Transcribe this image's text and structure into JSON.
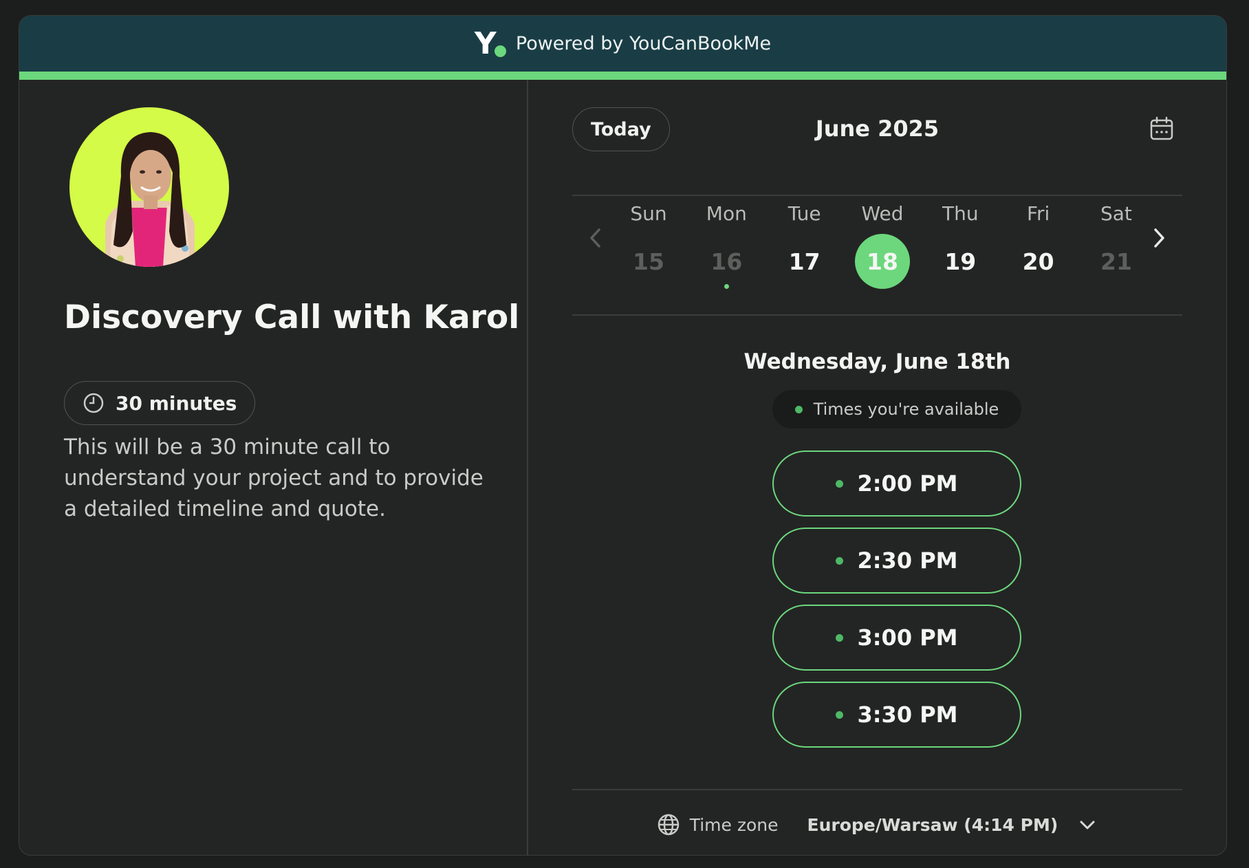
{
  "header": {
    "powered_by": "Powered by YouCanBookMe"
  },
  "profile": {
    "title": "Discovery Call with Karol",
    "duration": "30 minutes",
    "description": "This will be a 30 minute call to understand your project and to provide a detailed timeline and quote."
  },
  "calendar": {
    "today_label": "Today",
    "month": "June 2025",
    "days": [
      {
        "name": "Sun",
        "num": "15",
        "state": "muted",
        "has_dot": false
      },
      {
        "name": "Mon",
        "num": "16",
        "state": "muted",
        "has_dot": true
      },
      {
        "name": "Tue",
        "num": "17",
        "state": "available",
        "has_dot": false
      },
      {
        "name": "Wed",
        "num": "18",
        "state": "selected",
        "has_dot": false
      },
      {
        "name": "Thu",
        "num": "19",
        "state": "available",
        "has_dot": false
      },
      {
        "name": "Fri",
        "num": "20",
        "state": "available",
        "has_dot": false
      },
      {
        "name": "Sat",
        "num": "21",
        "state": "muted",
        "has_dot": false
      }
    ],
    "selected_date": "Wednesday, June 18th",
    "legend": "Times you're available",
    "slots": [
      "2:00 PM",
      "2:30 PM",
      "3:00 PM",
      "3:30 PM"
    ]
  },
  "timezone": {
    "label": "Time zone",
    "value": "Europe/Warsaw (4:14 PM)"
  },
  "colors": {
    "accent": "#6cd77d",
    "header_bg": "#1a3d45",
    "panel_bg": "#232524",
    "avatar_bg": "#d4fb47"
  }
}
